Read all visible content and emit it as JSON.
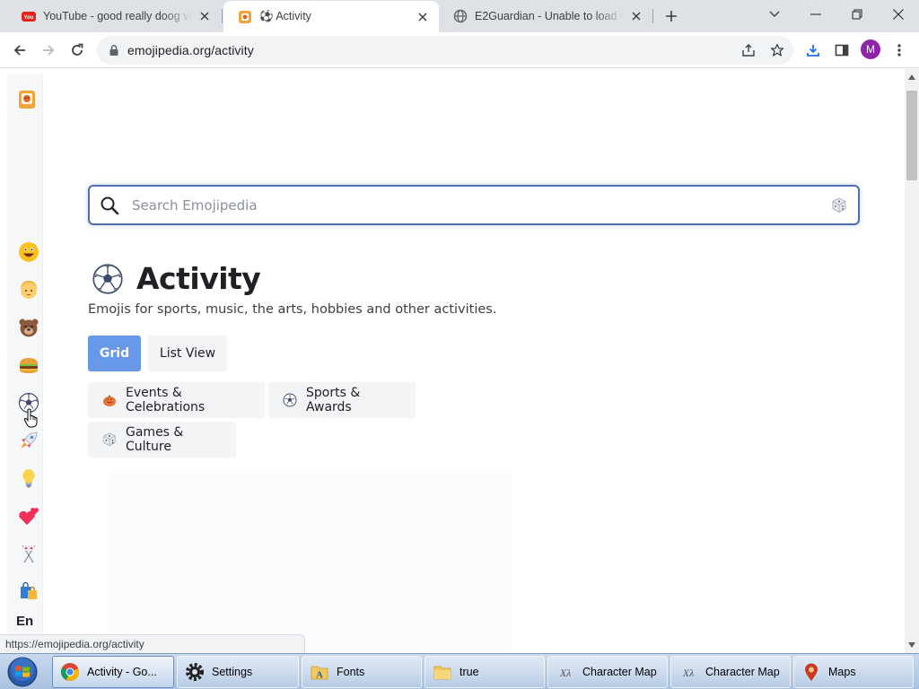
{
  "browser": {
    "tabs": [
      {
        "title": "YouTube - good really doog vide",
        "favicon": "youtube-icon",
        "active": false
      },
      {
        "title": "⚽ Activity",
        "favicon": "emojipedia-icon",
        "active": true
      },
      {
        "title": "E2Guardian - Unable to load web",
        "favicon": "globe-icon",
        "active": false
      }
    ],
    "address": "emojipedia.org/activity",
    "profile_initial": "M"
  },
  "sidebar": {
    "logo_icon": "emojipedia-logo-icon",
    "items": [
      {
        "name": "smileys-people",
        "icon": "grinning-face-icon"
      },
      {
        "name": "people",
        "icon": "person-face-icon"
      },
      {
        "name": "animals-nature",
        "icon": "bear-face-icon"
      },
      {
        "name": "food-drink",
        "icon": "hamburger-icon"
      },
      {
        "name": "activity",
        "icon": "soccer-ball-icon"
      },
      {
        "name": "travel-places",
        "icon": "rocket-icon"
      },
      {
        "name": "objects",
        "icon": "light-bulb-icon"
      },
      {
        "name": "symbols",
        "icon": "two-hearts-icon"
      },
      {
        "name": "flags",
        "icon": "crossed-flags-icon"
      },
      {
        "name": "new",
        "icon": "shopping-bags-icon"
      }
    ],
    "language": "En"
  },
  "search": {
    "placeholder": "Search Emojipedia"
  },
  "page": {
    "title": "Activity",
    "description": "Emojis for sports, music, the arts, hobbies and other activities.",
    "view_grid": "Grid",
    "view_list": "List View",
    "active_view": "Grid",
    "categories": [
      {
        "label": "Events & Celebrations",
        "icon": "jack-o-lantern-icon"
      },
      {
        "label": "Sports & Awards",
        "icon": "soccer-ball-icon"
      },
      {
        "label": "Games & Culture",
        "icon": "game-die-icon"
      }
    ]
  },
  "status_bar": {
    "hover_url": "https://emojipedia.org/activity"
  },
  "taskbar": {
    "items": [
      {
        "label": "Activity - Go...",
        "icon": "chrome-icon",
        "active": true
      },
      {
        "label": "Settings",
        "icon": "gear-icon",
        "active": false
      },
      {
        "label": "Fonts",
        "icon": "fonts-folder-icon",
        "active": false
      },
      {
        "label": "true",
        "icon": "folder-icon",
        "active": false
      },
      {
        "label": "Character Map",
        "icon": "character-map-icon",
        "active": false
      },
      {
        "label": "Character Map",
        "icon": "character-map-icon",
        "active": false
      },
      {
        "label": "Maps",
        "icon": "maps-icon",
        "active": false
      }
    ]
  },
  "colors": {
    "accent": "#6898e8",
    "search_border": "#4f6fb3",
    "profile": "#8e24aa",
    "chip_bg": "#f3f4f6"
  }
}
